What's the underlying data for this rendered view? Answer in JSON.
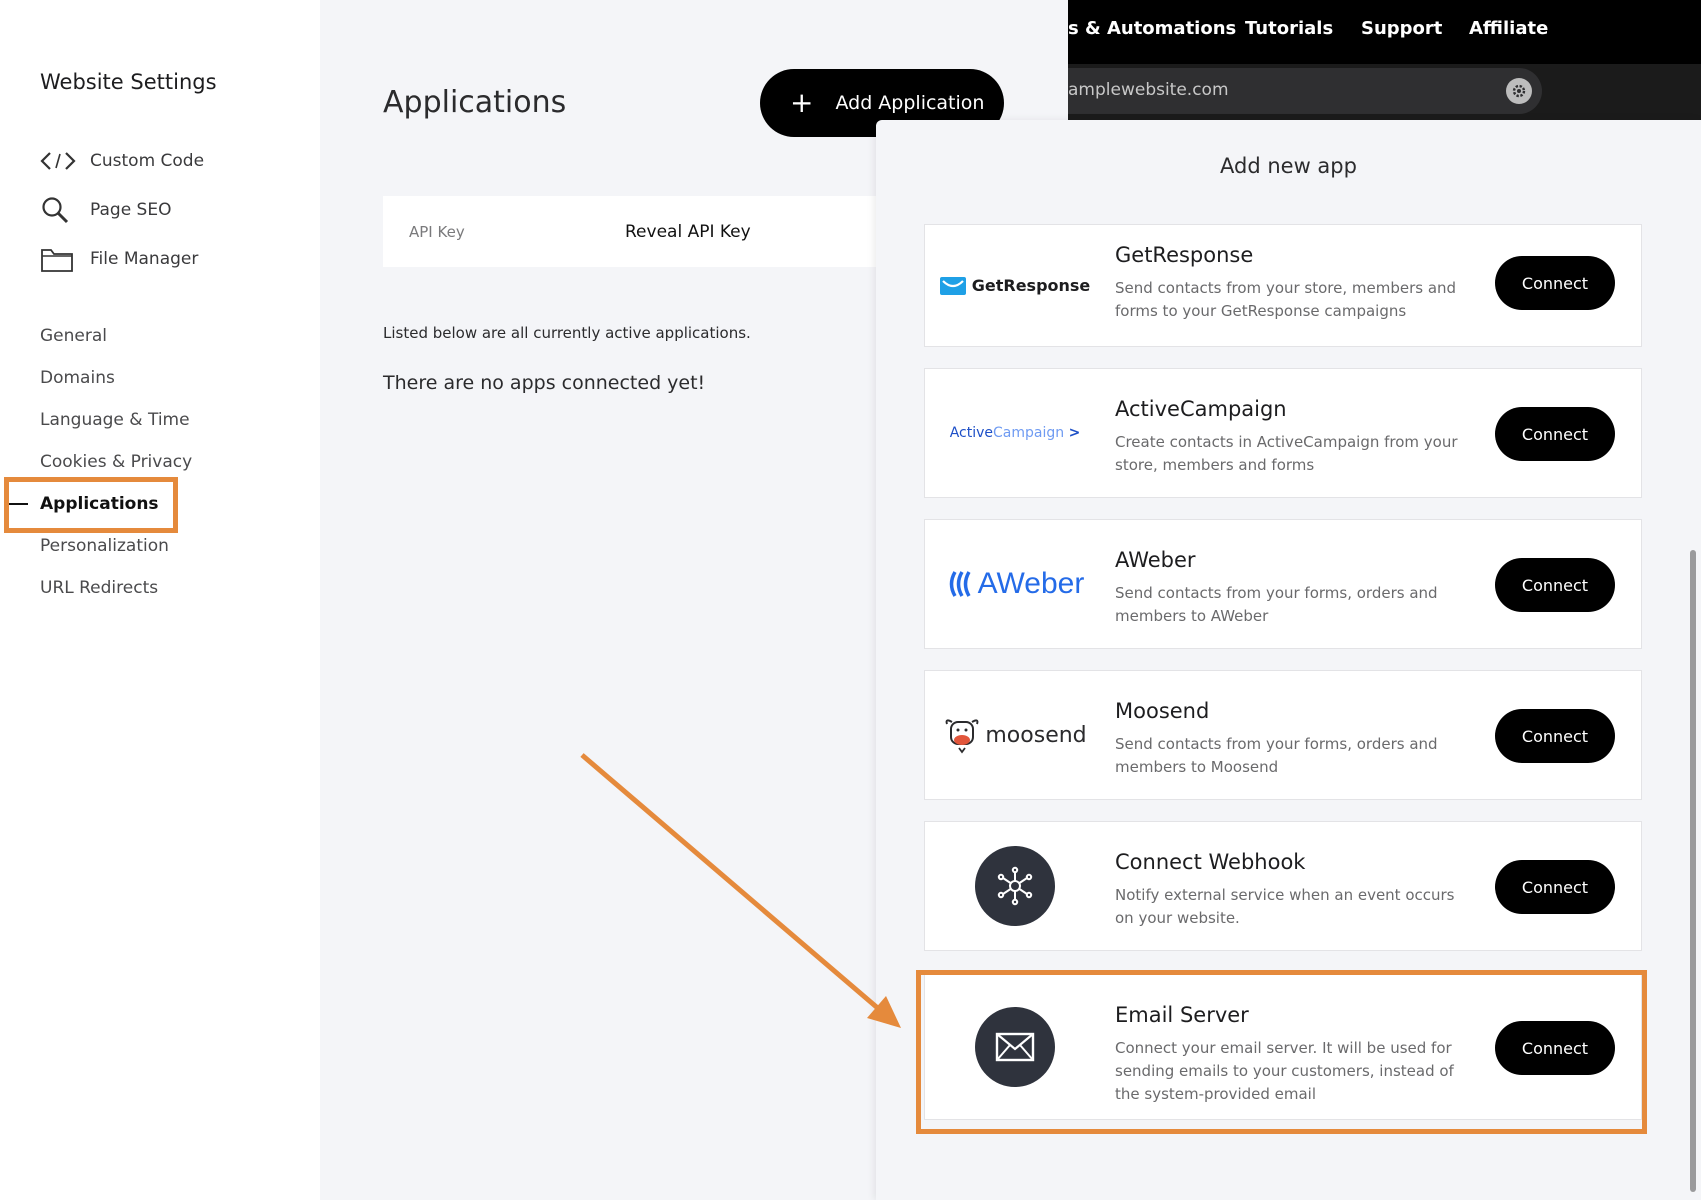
{
  "sidebar": {
    "title": "Website Settings",
    "tools": [
      {
        "label": "Custom Code",
        "icon": "code-icon"
      },
      {
        "label": "Page SEO",
        "icon": "search-icon"
      },
      {
        "label": "File Manager",
        "icon": "folder-icon"
      }
    ],
    "nav": [
      {
        "label": "General"
      },
      {
        "label": "Domains"
      },
      {
        "label": "Language & Time"
      },
      {
        "label": "Cookies & Privacy"
      },
      {
        "label": "Applications",
        "active": true
      },
      {
        "label": "Personalization"
      },
      {
        "label": "URL Redirects"
      }
    ]
  },
  "main": {
    "title": "Applications",
    "add_button": "Add Application",
    "api_label": "API Key",
    "api_value": "Reveal API Key",
    "listed_text": "Listed below are all currently active applications.",
    "empty_text": "There are no apps connected yet!"
  },
  "topnav": {
    "items": [
      "s & Automations",
      "Tutorials",
      "Support",
      "Affiliate"
    ],
    "url": "amplewebsite.com"
  },
  "modal": {
    "title": "Add new app",
    "connect_label": "Connect",
    "apps": [
      {
        "name": "GetResponse",
        "logo_text": "GetResponse",
        "description": "Send contacts from your store, members and forms to your GetResponse campaigns"
      },
      {
        "name": "ActiveCampaign",
        "logo_text_a": "Active",
        "logo_text_b": "Campaign",
        "logo_mark": ">",
        "description": "Create contacts in ActiveCampaign from your store, members and forms"
      },
      {
        "name": "AWeber",
        "logo_text": "AWeber",
        "description": "Send contacts from your forms, orders and members to AWeber"
      },
      {
        "name": "Moosend",
        "logo_text": "moosend",
        "description": "Send contacts from your forms, orders and members to Moosend"
      },
      {
        "name": "Connect Webhook",
        "icon": "webhook-icon",
        "description": "Notify external service when an event occurs on your website."
      },
      {
        "name": "Email Server",
        "icon": "envelope-icon",
        "description": "Connect your email server. It will be used for sending emails to your customers, instead of the system-provided email"
      }
    ]
  },
  "colors": {
    "highlight": "#e58a3c",
    "button": "#000000",
    "panel_bg": "#f4f5f8",
    "activecampaign_blue": "#356ae6",
    "aweber_blue": "#246be8"
  }
}
